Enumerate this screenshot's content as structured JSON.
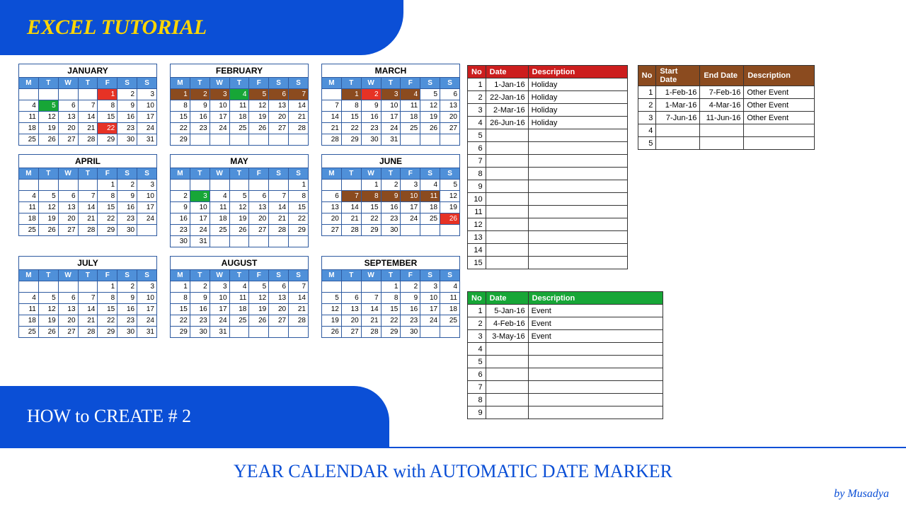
{
  "banner": {
    "top": "EXCEL TUTORIAL",
    "mid": "HOW to CREATE # 2"
  },
  "footer": {
    "title": "YEAR CALENDAR with AUTOMATIC DATE MARKER",
    "author": "by Musadya"
  },
  "dow": [
    "M",
    "T",
    "W",
    "T",
    "F",
    "S",
    "S"
  ],
  "months": [
    {
      "name": "JANUARY",
      "first": 4,
      "days": 31,
      "hl": {
        "1": "red",
        "5": "green",
        "22": "red"
      }
    },
    {
      "name": "FEBRUARY",
      "first": 0,
      "days": 29,
      "hl": {
        "1": "brown",
        "2": "brown",
        "3": "brown",
        "4": "green",
        "5": "brown",
        "6": "brown",
        "7": "brown"
      }
    },
    {
      "name": "MARCH",
      "first": 1,
      "days": 31,
      "hl": {
        "1": "brown",
        "2": "red",
        "3": "brown",
        "4": "brown"
      }
    },
    {
      "name": "APRIL",
      "first": 4,
      "days": 30,
      "hl": {}
    },
    {
      "name": "MAY",
      "first": 6,
      "days": 31,
      "hl": {
        "3": "green"
      }
    },
    {
      "name": "JUNE",
      "first": 2,
      "days": 30,
      "hl": {
        "7": "brown",
        "8": "brown",
        "9": "brown",
        "10": "brown",
        "11": "brown",
        "26": "red"
      }
    },
    {
      "name": "JULY",
      "first": 4,
      "days": 31,
      "hl": {}
    },
    {
      "name": "AUGUST",
      "first": 0,
      "days": 31,
      "hl": {}
    },
    {
      "name": "SEPTEMBER",
      "first": 3,
      "days": 30,
      "hl": {}
    }
  ],
  "holiday_table": {
    "headers": [
      "No",
      "Date",
      "Description"
    ],
    "rows": [
      [
        "1",
        "1-Jan-16",
        "Holiday"
      ],
      [
        "2",
        "22-Jan-16",
        "Holiday"
      ],
      [
        "3",
        "2-Mar-16",
        "Holiday"
      ],
      [
        "4",
        "26-Jun-16",
        "Holiday"
      ],
      [
        "5",
        "",
        ""
      ],
      [
        "6",
        "",
        ""
      ],
      [
        "7",
        "",
        ""
      ],
      [
        "8",
        "",
        ""
      ],
      [
        "9",
        "",
        ""
      ],
      [
        "10",
        "",
        ""
      ],
      [
        "11",
        "",
        ""
      ],
      [
        "12",
        "",
        ""
      ],
      [
        "13",
        "",
        ""
      ],
      [
        "14",
        "",
        ""
      ],
      [
        "15",
        "",
        ""
      ]
    ]
  },
  "event_table": {
    "headers": [
      "No",
      "Date",
      "Description"
    ],
    "rows": [
      [
        "1",
        "5-Jan-16",
        "Event"
      ],
      [
        "2",
        "4-Feb-16",
        "Event"
      ],
      [
        "3",
        "3-May-16",
        "Event"
      ],
      [
        "4",
        "",
        ""
      ],
      [
        "5",
        "",
        ""
      ],
      [
        "6",
        "",
        ""
      ],
      [
        "7",
        "",
        ""
      ],
      [
        "8",
        "",
        ""
      ],
      [
        "9",
        "",
        ""
      ]
    ]
  },
  "other_table": {
    "headers": [
      "No",
      "Start Date",
      "End Date",
      "Description"
    ],
    "rows": [
      [
        "1",
        "1-Feb-16",
        "7-Feb-16",
        "Other Event"
      ],
      [
        "2",
        "1-Mar-16",
        "4-Mar-16",
        "Other Event"
      ],
      [
        "3",
        "7-Jun-16",
        "11-Jun-16",
        "Other Event"
      ],
      [
        "4",
        "",
        "",
        ""
      ],
      [
        "5",
        "",
        "",
        ""
      ]
    ]
  }
}
